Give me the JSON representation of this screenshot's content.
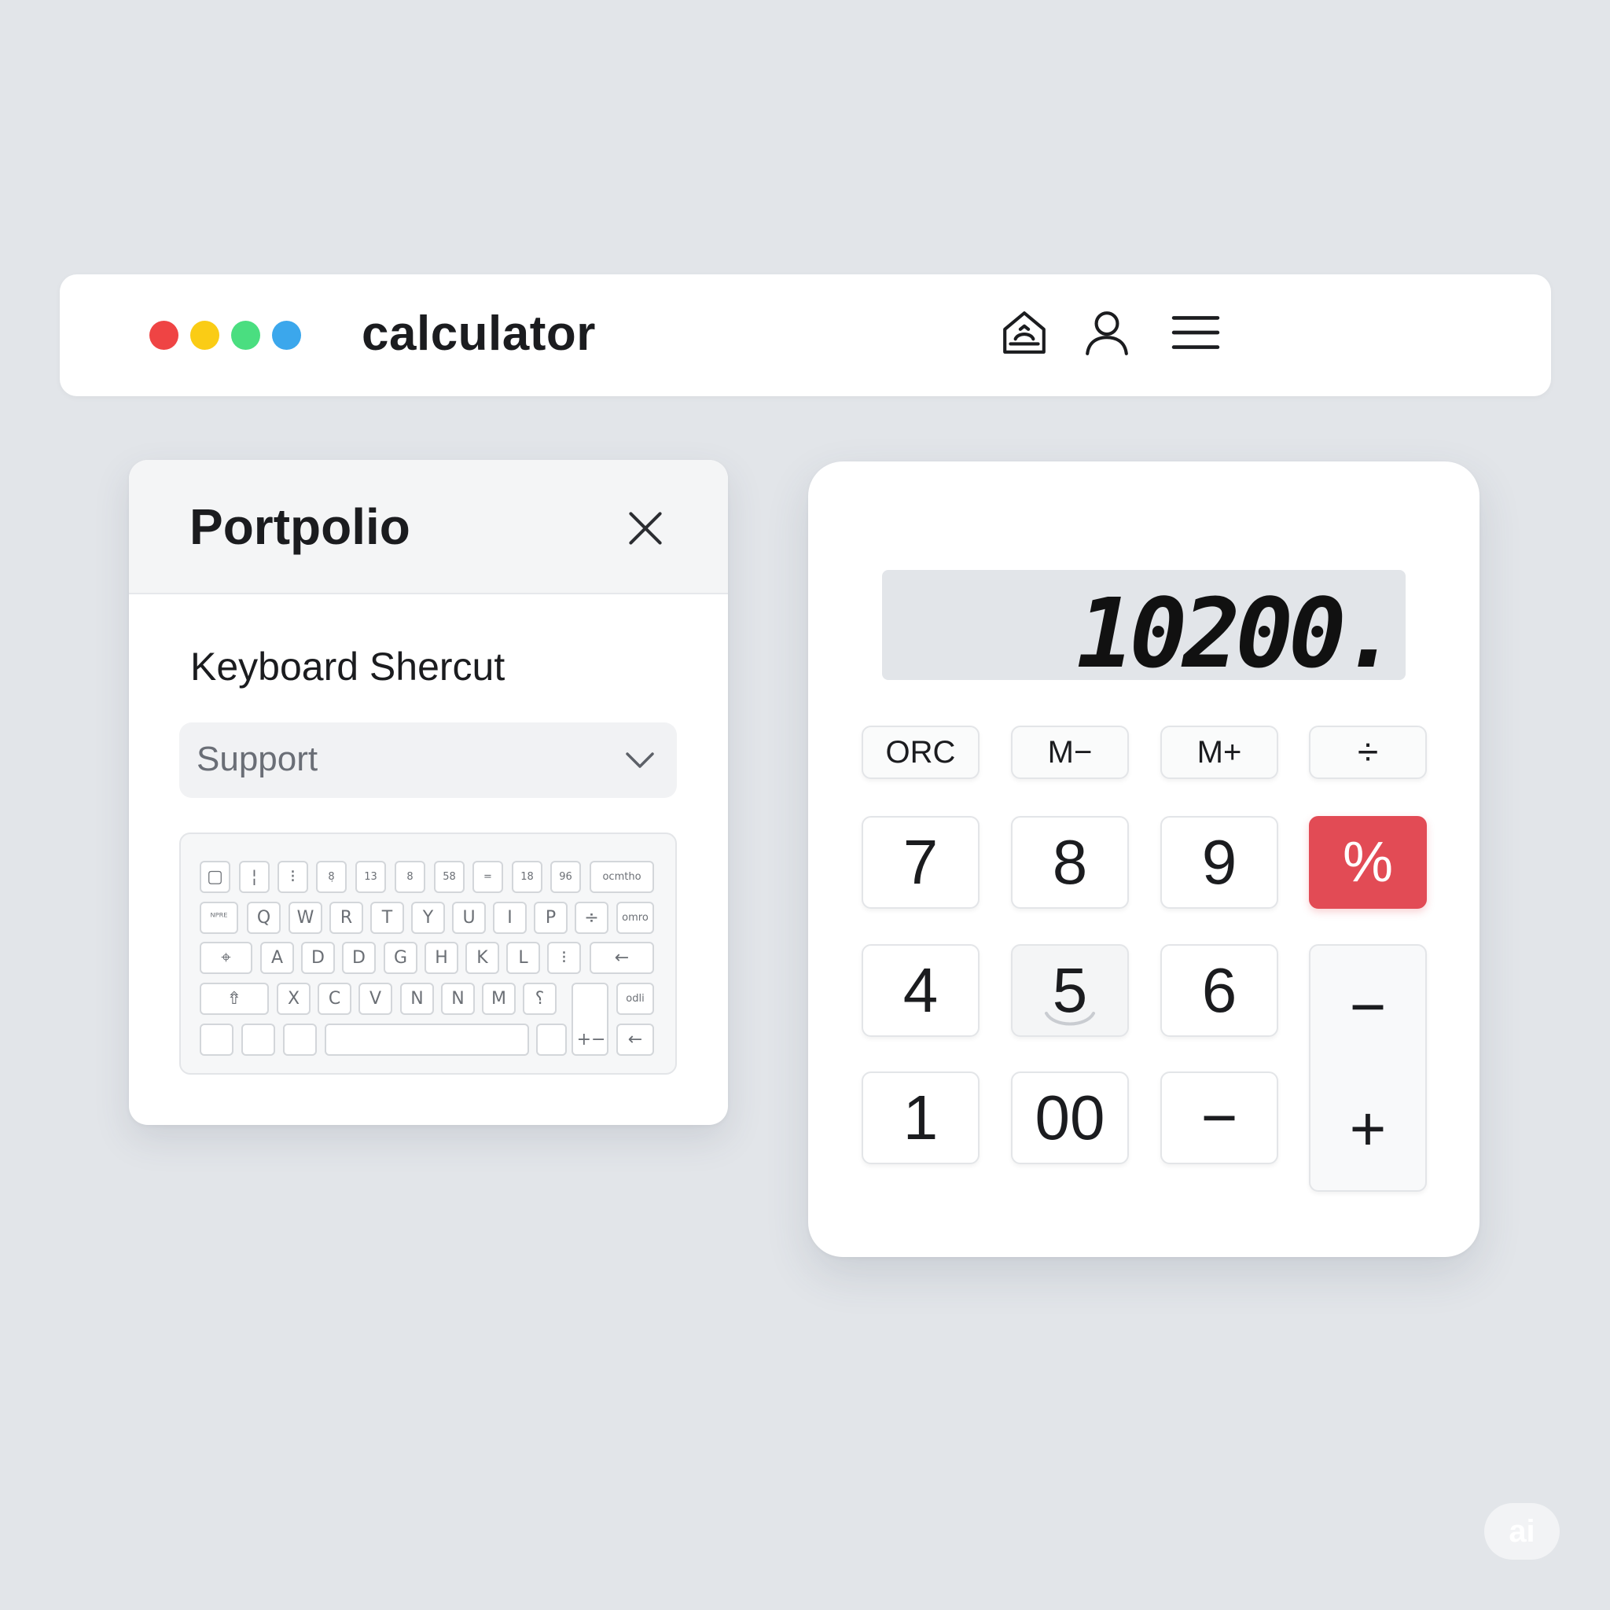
{
  "window": {
    "title": "calculator",
    "traffic_lights": [
      {
        "name": "red-dot",
        "color": "#ef4444"
      },
      {
        "name": "yellow-dot",
        "color": "#facc15"
      },
      {
        "name": "green-dot",
        "color": "#4ade80"
      },
      {
        "name": "blue-dot",
        "color": "#3ba7ec"
      }
    ],
    "icons": [
      "home-icon",
      "user-icon",
      "menu-icon"
    ]
  },
  "panel": {
    "title": "Portpolio",
    "close_icon": "close-icon",
    "section_label": "Keyboard Shercut",
    "select": {
      "value": "Support",
      "icon": "chevron-down-icon"
    },
    "keyboard": {
      "rows": [
        [
          "▢",
          "¦",
          "⁝",
          "8̣",
          "13",
          "8",
          "58",
          "=",
          "18",
          "96",
          "ocmtho"
        ],
        [
          "ᴺᴾᴿᴱ",
          "Q",
          "W",
          "R",
          "T",
          "Y",
          "U",
          "I",
          "P",
          "÷",
          "omro"
        ],
        [
          "⌖",
          "A",
          "D",
          "D",
          "G",
          "H",
          "K",
          "L",
          "⁝",
          "←"
        ],
        [
          "⇮",
          "X",
          "C",
          "V",
          "N",
          "N",
          "M",
          "⸮",
          "",
          "odli"
        ],
        [
          "",
          "",
          "",
          "",
          "",
          "+−",
          "←"
        ]
      ]
    }
  },
  "calculator": {
    "display": "10200.",
    "accent_color": "#e24b55",
    "function_keys": [
      "ORC",
      "M−",
      "M+",
      "÷"
    ],
    "keys": {
      "row1": [
        "7",
        "8",
        "9",
        "%"
      ],
      "row2": [
        "4",
        "5",
        "6"
      ],
      "row3": [
        "1",
        "00",
        "−"
      ],
      "tall_key": [
        "−",
        "+"
      ]
    }
  },
  "watermark": "ai"
}
